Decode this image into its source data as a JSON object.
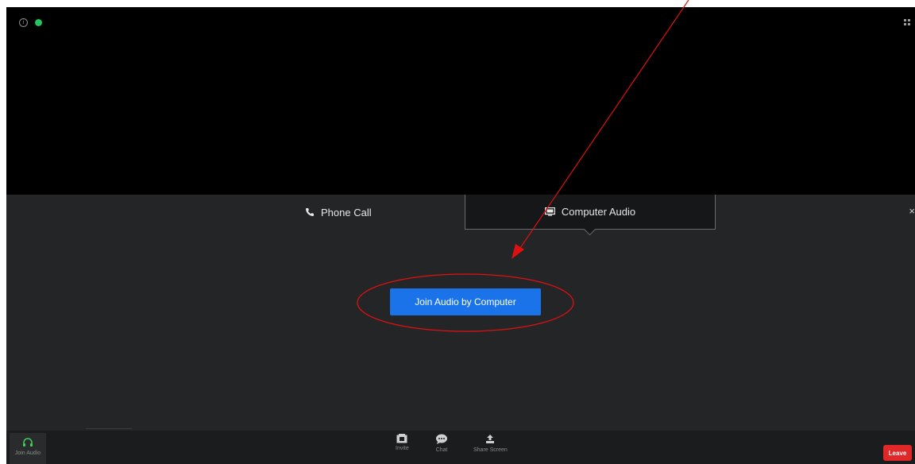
{
  "audio_dialog": {
    "tabs": [
      {
        "label": "Phone Call",
        "icon": "phone-icon"
      },
      {
        "label": "Computer Audio",
        "icon": "monitor-icon"
      }
    ],
    "close_icon": "×",
    "join_button_label": "Join Audio by Computer"
  },
  "toolbar": {
    "join_audio_label": "Join Audio",
    "invite_label": "Invite",
    "chat_label": "Chat",
    "share_label": "Share Screen",
    "leave_label": "Leave"
  },
  "colors": {
    "accent_blue": "#1a73e8",
    "leave_red": "#e02828",
    "annotation_red": "#e01010",
    "secure_green": "#22c55e"
  }
}
